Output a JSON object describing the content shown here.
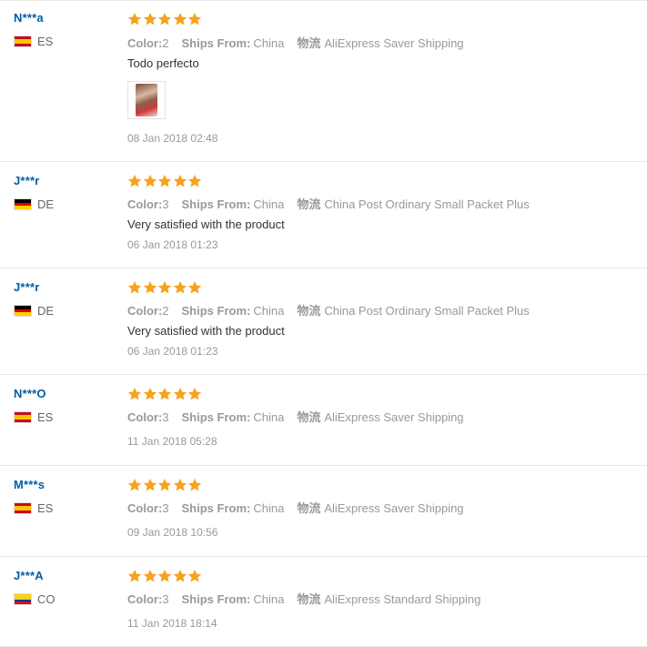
{
  "colors": {
    "star": "#f7a21c",
    "username": "#005da3",
    "muted": "#999999",
    "divider": "#e8e8e8"
  },
  "labels": {
    "color": "Color:",
    "ships_from": "Ships From:",
    "shipping": "物流"
  },
  "reviews": [
    {
      "user": "N***a",
      "country": "ES",
      "rating": 5,
      "color": "2",
      "ships_from": "China",
      "shipping": "AliExpress Saver Shipping",
      "text": "Todo perfecto",
      "has_image": true,
      "date": "08 Jan 2018 02:48"
    },
    {
      "user": "J***r",
      "country": "DE",
      "rating": 5,
      "color": "3",
      "ships_from": "China",
      "shipping": "China Post Ordinary Small Packet Plus",
      "text": "Very satisfied with the product",
      "has_image": false,
      "date": "06 Jan 2018 01:23"
    },
    {
      "user": "J***r",
      "country": "DE",
      "rating": 5,
      "color": "2",
      "ships_from": "China",
      "shipping": "China Post Ordinary Small Packet Plus",
      "text": "Very satisfied with the product",
      "has_image": false,
      "date": "06 Jan 2018 01:23"
    },
    {
      "user": "N***O",
      "country": "ES",
      "rating": 5,
      "color": "3",
      "ships_from": "China",
      "shipping": "AliExpress Saver Shipping",
      "text": "",
      "has_image": false,
      "date": "11 Jan 2018 05:28"
    },
    {
      "user": "M***s",
      "country": "ES",
      "rating": 5,
      "color": "3",
      "ships_from": "China",
      "shipping": "AliExpress Saver Shipping",
      "text": "",
      "has_image": false,
      "date": "09 Jan 2018 10:56"
    },
    {
      "user": "J***A",
      "country": "CO",
      "rating": 5,
      "color": "3",
      "ships_from": "China",
      "shipping": "AliExpress Standard Shipping",
      "text": "",
      "has_image": false,
      "date": "11 Jan 2018 18:14"
    }
  ]
}
